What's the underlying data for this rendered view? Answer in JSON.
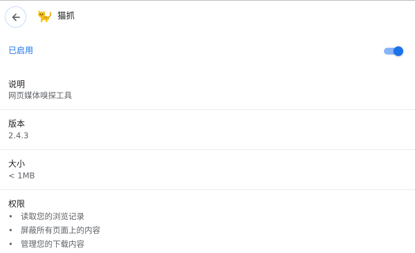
{
  "header": {
    "extension_name": "猫抓"
  },
  "enabled_row": {
    "label": "已启用",
    "toggle_on": true,
    "accent_color": "#1a73e8"
  },
  "details": {
    "description": {
      "title": "说明",
      "value": "网页媒体嗅探工具"
    },
    "version": {
      "title": "版本",
      "value": "2.4.3"
    },
    "size": {
      "title": "大小",
      "value": "< 1MB"
    },
    "permissions": {
      "title": "权限",
      "items": [
        "读取您的浏览记录",
        "屏蔽所有页面上的内容",
        "管理您的下载内容"
      ]
    }
  },
  "icons": {
    "back": "arrow-left-icon",
    "logo": "cat-logo-icon"
  }
}
